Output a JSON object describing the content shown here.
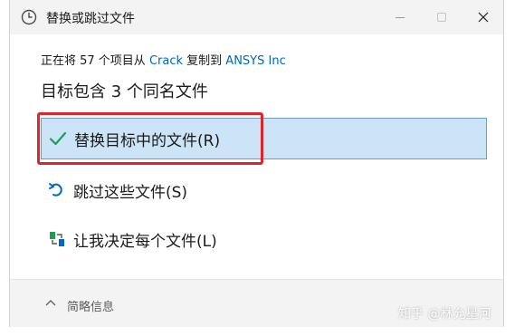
{
  "window": {
    "title": "替换或跳过文件"
  },
  "dialog": {
    "subtitle_prefix": "正在将 57 个项目从 ",
    "source": "Crack",
    "subtitle_mid": " 复制到 ",
    "destination": "ANSYS Inc",
    "heading": "目标包含 3 个同名文件",
    "options": [
      {
        "label": "替换目标中的文件(R)",
        "icon": "checkmark-icon",
        "selected": true
      },
      {
        "label": "跳过这些文件(S)",
        "icon": "skip-arrow-icon",
        "selected": false
      },
      {
        "label": "让我决定每个文件(L)",
        "icon": "compare-files-icon",
        "selected": false
      }
    ]
  },
  "footer": {
    "details_label": "简略信息"
  },
  "watermark": "知乎 @林允星河",
  "colors": {
    "accent": "#0067c0",
    "selected_bg": "#cce4f7",
    "highlight_red": "#e0242b",
    "check_green": "#1f9d55"
  }
}
